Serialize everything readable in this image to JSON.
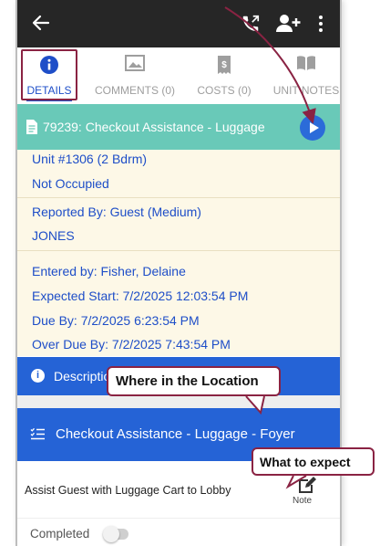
{
  "tabs": [
    {
      "label": "DETAILS",
      "icon": "info-icon",
      "active": true
    },
    {
      "label": "COMMENTS (0)",
      "icon": "comment-image-icon"
    },
    {
      "label": "COSTS (0)",
      "icon": "dollar-receipt-icon"
    },
    {
      "label": "UNIT NOTES",
      "icon": "book-icon"
    }
  ],
  "ticket": {
    "title": "79239: Checkout Assistance - Luggage"
  },
  "info": {
    "unit": "Unit #1306 (2 Bdrm)",
    "occupancy": "Not Occupied",
    "reported_by": "Reported By: Guest  (Medium)",
    "reporter_name": "JONES",
    "entered_by": "Entered by: Fisher, Delaine",
    "expected_start": "Expected Start: 7/2/2025 12:03:54 PM",
    "due_by": "Due By: 7/2/2025 6:23:54 PM",
    "over_due_by": "Over Due By: 7/2/2025 7:43:54 PM"
  },
  "description_bar": {
    "label": "Description"
  },
  "task_section": {
    "title": "Checkout Assistance - Luggage - Foyer"
  },
  "task": {
    "description": "Assist Guest with Luggage Cart to Lobby",
    "note_label": "Note"
  },
  "completed": {
    "label": "Completed",
    "on": false
  },
  "callouts": {
    "location": "Where in the Location",
    "expect": "What to expect"
  },
  "colors": {
    "accent": "#1e4ec8",
    "ticket_header": "#69c9b8",
    "section_bar": "#2563d6",
    "info_bg": "#fdf8e7",
    "annotation": "#8a2343"
  }
}
